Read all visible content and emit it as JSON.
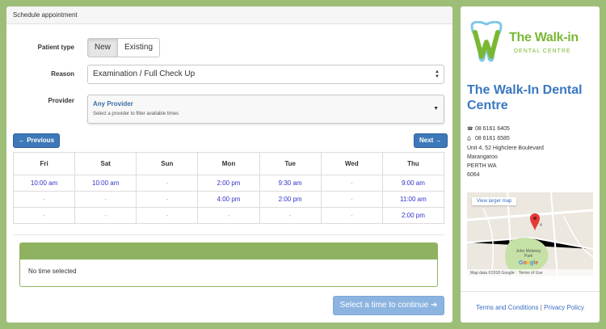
{
  "panel_title": "Schedule appointment",
  "form": {
    "patient_type_label": "Patient type",
    "patient_type_options": [
      "New",
      "Existing"
    ],
    "reason_label": "Reason",
    "reason_value": "Examination / Full Check Up",
    "provider_label": "Provider",
    "provider_value": "Any Provider",
    "provider_hint": "Select a provider to filter available times"
  },
  "nav": {
    "previous": "← Previous",
    "next": "Next →"
  },
  "calendar": {
    "days": [
      "Fri",
      "Sat",
      "Sun",
      "Mon",
      "Tue",
      "Wed",
      "Thu"
    ],
    "rows": [
      [
        "10:00 am",
        "10:00 am",
        "-",
        "2:00 pm",
        "9:30 am",
        "-",
        "9:00 am"
      ],
      [
        "-",
        "-",
        "-",
        "4:00 pm",
        "2:00 pm",
        "-",
        "11:00 am"
      ],
      [
        "-",
        "-",
        "-",
        "-",
        "-",
        "-",
        "2:00 pm"
      ]
    ]
  },
  "selection": {
    "status": "No time selected"
  },
  "continue_label": "Select a time to continue ➔",
  "clinic": {
    "logo_line1": "The Walk-in",
    "logo_line2": "DENTAL CENTRE",
    "name": "The Walk-In Dental Centre",
    "phone": "08 6161 6405",
    "fax": "08 6161 6585",
    "address_line1": "Unit 4, 52 Highclere Boulevard",
    "address_line2": "Marangaroo",
    "address_line3": "PERTH WA",
    "address_line4": "6064"
  },
  "map": {
    "link": "View larger map",
    "park_label": "John Moloney Park",
    "marker_label": "4",
    "footer_data": "Map data ©2018 Google",
    "footer_terms": "Terms of Use"
  },
  "footer": {
    "terms": "Terms and Conditions",
    "separator": "|",
    "privacy": "Privacy Policy"
  },
  "colors": {
    "background": "#9dbe77",
    "primary": "#3d78b8",
    "accent_green": "#7ab833",
    "clinic_blue": "#3a78c2"
  }
}
